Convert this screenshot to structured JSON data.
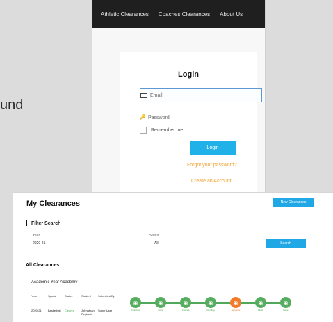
{
  "login": {
    "nav": [
      "Athletic Clearances",
      "Coaches Clearances",
      "About Us"
    ],
    "title": "Login",
    "email_placeholder": "Email",
    "password_placeholder": "Password",
    "remember_label": "Remember me",
    "login_label": "Login",
    "forgot_label": "Forgot your password?",
    "create_label": "Create an Account"
  },
  "background": {
    "tagline": "und"
  },
  "clearances": {
    "title": "My Clearances",
    "new_button": "New Clearances",
    "filter_title": "Filter Search",
    "year_label": "Year",
    "year_value": "2020-21",
    "status_label": "Status",
    "status_value": "All",
    "search_label": "Search",
    "all_title": "All Clearances",
    "year_title": "Academic Year Academy",
    "columns": [
      "Year",
      "Sports",
      "Status",
      "Student",
      "Submitted By"
    ],
    "row": [
      "2020-21",
      "Basketball",
      "Cleared",
      "Johnathan Reginald",
      "Super User"
    ],
    "steps": [
      {
        "label": "Finished",
        "color": "green"
      },
      {
        "label": "Docs",
        "color": "green"
      },
      {
        "label": "Cleared",
        "color": "green"
      },
      {
        "label": "Pending",
        "color": "green"
      },
      {
        "label": "Signature",
        "color": "orange"
      },
      {
        "label": "Finish",
        "color": "green"
      },
      {
        "label": "Done",
        "color": "green"
      }
    ]
  }
}
